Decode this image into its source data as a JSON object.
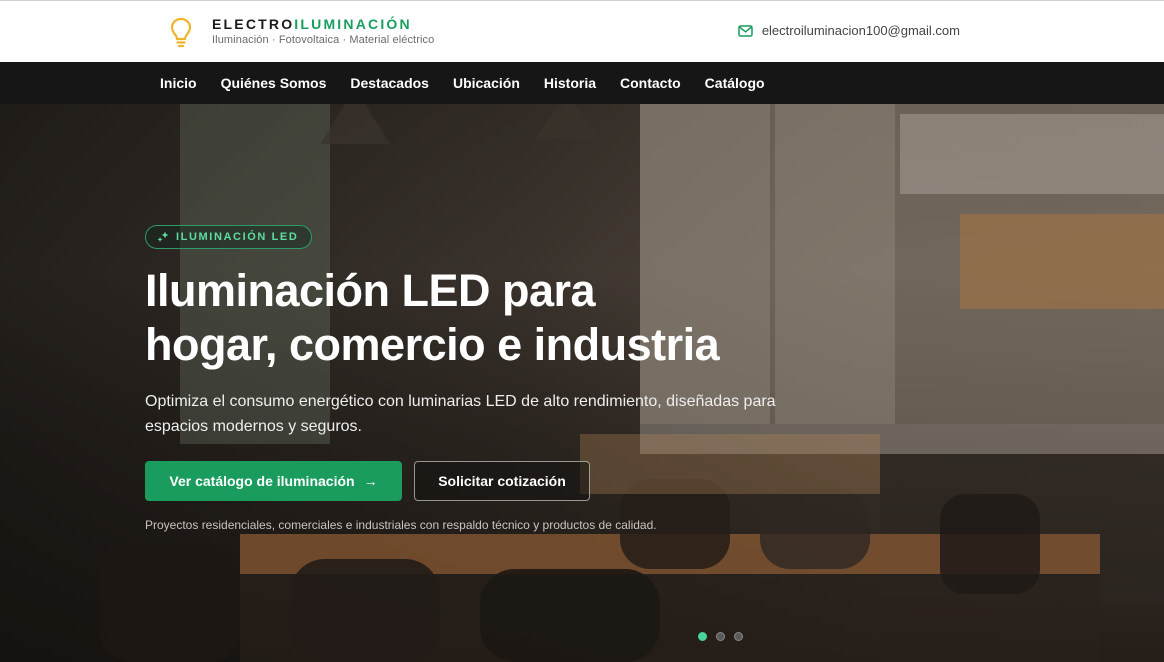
{
  "header": {
    "brand_part1": "ELECTRO",
    "brand_part2": "ILUMINACIÓN",
    "tagline": "Iluminación · Fotovoltaica · Material eléctrico",
    "email": "electroiluminacion100@gmail.com",
    "logo_icon": "lightbulb-icon",
    "mail_icon": "mail-icon"
  },
  "nav": {
    "items": [
      "Inicio",
      "Quiénes Somos",
      "Destacados",
      "Ubicación",
      "Historia",
      "Contacto",
      "Catálogo"
    ]
  },
  "hero": {
    "badge": "ILUMINACIÓN LED",
    "title_line1": "Iluminación LED para",
    "title_line2": "hogar, comercio e industria",
    "description": "Optimiza el consumo energético con luminarias LED de alto rendimiento, diseñadas para espacios modernos y seguros.",
    "primary_cta": "Ver catálogo de iluminación",
    "primary_cta_arrow": "→",
    "secondary_cta": "Solicitar cotización",
    "note": "Proyectos residenciales, comerciales e industriales con respaldo técnico y productos de calidad.",
    "slides_total": 3,
    "active_slide": 1
  },
  "colors": {
    "accent": "#1a9c5e",
    "badge_text": "#5fdca0",
    "nav_bg": "#161616"
  }
}
